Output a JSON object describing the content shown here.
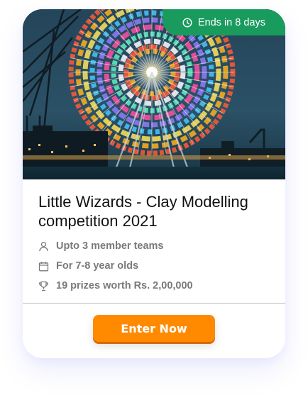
{
  "card": {
    "badge": {
      "icon": "clock-icon",
      "text": "Ends in 8 days",
      "color": "#1a9b5e"
    },
    "image": {
      "subject": "ferris-wheel-night-photo"
    },
    "title": "Little Wizards - Clay Modelling competition 2021",
    "details": [
      {
        "icon": "user-icon",
        "text": "Upto 3 member teams"
      },
      {
        "icon": "calendar-icon",
        "text": "For 7-8 year olds"
      },
      {
        "icon": "trophy-icon",
        "text": "19 prizes worth Rs. 2,00,000"
      }
    ],
    "cta": {
      "label": "Enter Now",
      "color": "#ff8a00"
    }
  }
}
